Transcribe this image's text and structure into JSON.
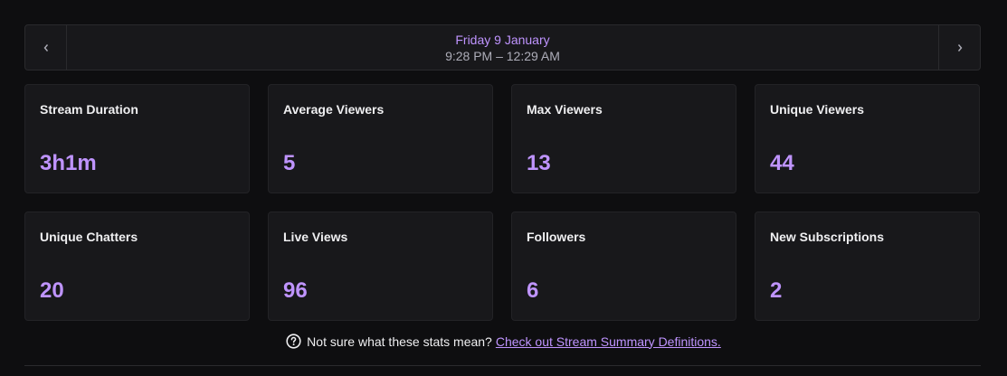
{
  "date_nav": {
    "day": "Friday 9 January",
    "time_range": "9:28 PM – 12:29 AM"
  },
  "stats": [
    {
      "label": "Stream Duration",
      "value": "3h1m"
    },
    {
      "label": "Average Viewers",
      "value": "5"
    },
    {
      "label": "Max Viewers",
      "value": "13"
    },
    {
      "label": "Unique Viewers",
      "value": "44"
    },
    {
      "label": "Unique Chatters",
      "value": "20"
    },
    {
      "label": "Live Views",
      "value": "96"
    },
    {
      "label": "Followers",
      "value": "6"
    },
    {
      "label": "New Subscriptions",
      "value": "2"
    }
  ],
  "help": {
    "text": "Not sure what these stats mean?",
    "link": "Check out Stream Summary Definitions."
  },
  "colors": {
    "background": "#0e0e10",
    "card": "#18181b",
    "accent": "#bf94ff"
  },
  "icons": {
    "prev": "chevron-left-icon",
    "next": "chevron-right-icon",
    "help": "question-circle-icon"
  }
}
